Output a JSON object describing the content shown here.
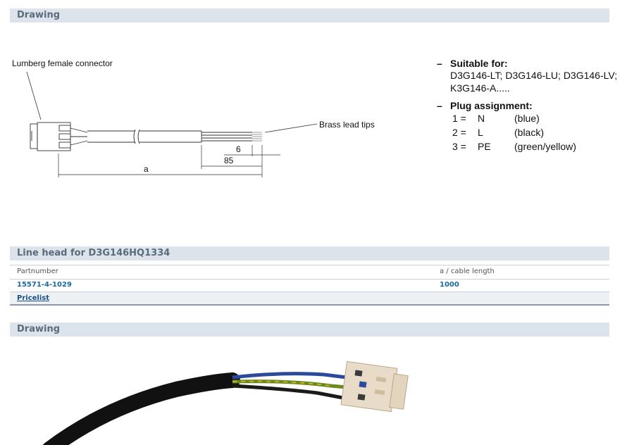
{
  "sections": {
    "drawing_title": "Drawing",
    "line_head_title": "Line head for D3G146HQ1334",
    "drawing2_title": "Drawing"
  },
  "drawing": {
    "connector_label": "Lumberg female connector",
    "tips_label": "Brass lead tips",
    "dim_6": "6",
    "dim_85": "85",
    "dim_a": "a"
  },
  "specs": {
    "suitable_heading": "Suitable for:",
    "suitable_line1": "D3G146-LT; D3G146-LU; D3G146-LV;",
    "suitable_line2": "K3G146-A.....",
    "plug_heading": "Plug assignment:",
    "assignments": [
      {
        "num": "1 =",
        "code": "N",
        "color": "(blue)"
      },
      {
        "num": "2 =",
        "code": "L",
        "color": "(black)"
      },
      {
        "num": "3 =",
        "code": "PE",
        "color": "(green/yellow)"
      }
    ]
  },
  "table": {
    "col1_header": "Partnumber",
    "col2_header": "a / cable length",
    "rows": [
      {
        "partnumber": "15571-4-1029",
        "length": "1000"
      }
    ],
    "footer_link": "Pricelist"
  },
  "colors": {
    "section_bar": "#dde3ea",
    "section_text": "#5a6b7c",
    "link": "#1a4f8a",
    "value": "#1a6a9a"
  }
}
